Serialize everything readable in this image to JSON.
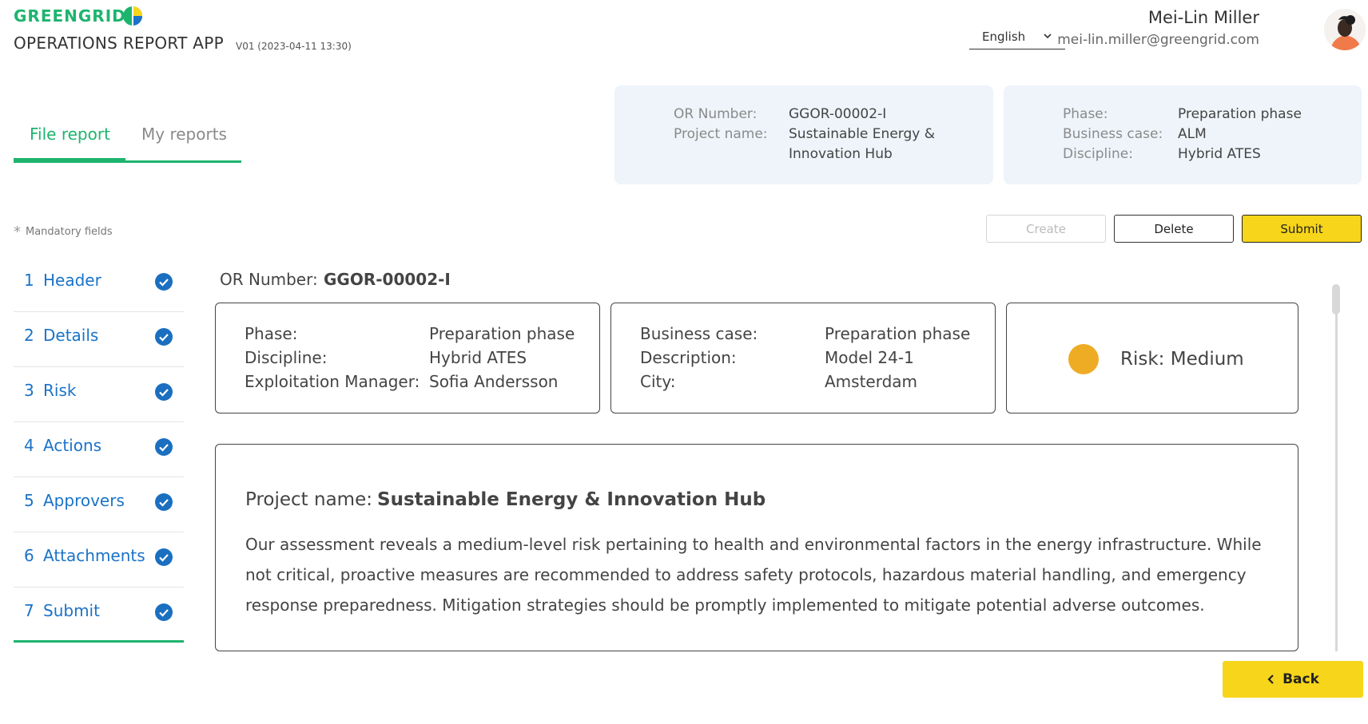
{
  "brand": {
    "name": "GREENGRID",
    "app_title": "OPERATIONS REPORT APP",
    "version": "V01 (2023-04-11 13:30)"
  },
  "language": {
    "selected": "English"
  },
  "user": {
    "name": "Mei-Lin Miller",
    "email": "mei-lin.miller@greengrid.com"
  },
  "tabs": [
    {
      "label": "File report",
      "active": true
    },
    {
      "label": "My reports",
      "active": false
    }
  ],
  "summary_left": {
    "or_number_label": "OR Number:",
    "or_number": "GGOR-00002-I",
    "project_name_label": "Project name:",
    "project_name_line1": "Sustainable Energy &",
    "project_name_line2": "Innovation Hub"
  },
  "summary_right": {
    "phase_label": "Phase:",
    "phase": "Preparation phase",
    "business_case_label": "Business case:",
    "business_case": "ALM",
    "discipline_label": "Discipline:",
    "discipline": "Hybrid ATES"
  },
  "mandatory": {
    "star": "*",
    "text": "Mandatory fields"
  },
  "actions": {
    "create": "Create",
    "delete": "Delete",
    "submit": "Submit"
  },
  "steps": [
    {
      "num": "1",
      "label": "Header"
    },
    {
      "num": "2",
      "label": "Details"
    },
    {
      "num": "3",
      "label": "Risk"
    },
    {
      "num": "4",
      "label": "Actions"
    },
    {
      "num": "5",
      "label": "Approvers"
    },
    {
      "num": "6",
      "label": "Attachments"
    },
    {
      "num": "7",
      "label": "Submit"
    }
  ],
  "content": {
    "or_label": "OR Number:",
    "or_value": "GGOR-00002-I",
    "card1": {
      "phase_label": "Phase:",
      "phase": "Preparation phase",
      "discipline_label": "Discipline:",
      "discipline": "Hybrid ATES",
      "manager_label": "Exploitation Manager:",
      "manager": "Sofia Andersson"
    },
    "card2": {
      "business_case_label": "Business case:",
      "business_case": "Preparation phase",
      "description_label": "Description:",
      "description": "Model 24-1",
      "city_label": "City:",
      "city": "Amsterdam"
    },
    "risk": {
      "text": "Risk: Medium",
      "color": "#eeac25"
    },
    "project": {
      "label": "Project name:",
      "value": "Sustainable Energy & Innovation Hub",
      "description": "Our assessment reveals a medium-level risk pertaining to health and environmental factors in the energy infrastructure. While not critical, proactive measures are recommended to address safety protocols, hazardous material handling, and emergency response preparedness. Mitigation strategies should be promptly implemented to mitigate potential adverse outcomes."
    }
  },
  "back": {
    "label": "Back"
  },
  "colors": {
    "accent_green": "#1eb46e",
    "accent_blue": "#1a73c8",
    "primary_yellow": "#f7d51a"
  }
}
